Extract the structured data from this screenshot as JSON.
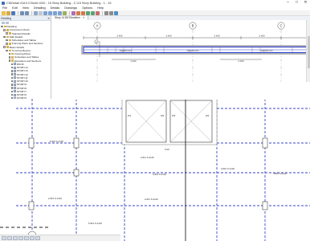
{
  "window": {
    "title": "CSiDetail v18.0.0 Build 1020 - 15 Story Building - C:\\15 Story Building - 1 - 15",
    "minimize_glyph": "–",
    "maximize_glyph": "□",
    "close_glyph": "✕"
  },
  "menu": [
    "File",
    "Edit",
    "View",
    "Detailing",
    "Details",
    "Drawings",
    "Options",
    "Help"
  ],
  "left_pane": {
    "header": "Detailing",
    "close_glyph": "✕",
    "tree": [
      {
        "label": "Detailing",
        "level": 0,
        "expand": "−",
        "kind": "folder"
      },
      {
        "label": "Component Views",
        "level": 1,
        "expand": "−",
        "kind": "folder"
      },
      {
        "label": "Standard Details",
        "level": 2,
        "expand": "+",
        "kind": "folder"
      },
      {
        "label": "Slab Details",
        "level": 1,
        "expand": "−",
        "kind": "folder"
      },
      {
        "label": "Schedules and Tables",
        "level": 2,
        "expand": "+",
        "kind": "folder"
      },
      {
        "label": "Framing Plans and Sections",
        "level": 2,
        "expand": "+",
        "kind": "folder"
      },
      {
        "label": "Beam Details",
        "level": 1,
        "expand": "−",
        "kind": "folder"
      },
      {
        "label": "Concrete Beams",
        "level": 2,
        "expand": "−",
        "kind": "folder"
      },
      {
        "label": "Framing Plans",
        "level": 3,
        "expand": "+",
        "kind": "folder"
      },
      {
        "label": "Schedules and Tables",
        "level": 3,
        "expand": "+",
        "kind": "folder"
      },
      {
        "label": "Elevations and Sections",
        "level": 3,
        "expand": "−",
        "kind": "folder"
      },
      {
        "label": "ROOF",
        "level": 4,
        "expand": "+",
        "kind": "doc"
      },
      {
        "label": "STORY14",
        "level": 4,
        "expand": "+",
        "kind": "doc"
      },
      {
        "label": "STORY13",
        "level": 4,
        "expand": "+",
        "kind": "doc"
      },
      {
        "label": "STORY12",
        "level": 4,
        "expand": "+",
        "kind": "doc"
      },
      {
        "label": "STORY11",
        "level": 4,
        "expand": "+",
        "kind": "doc"
      },
      {
        "label": "STORY10",
        "level": 4,
        "expand": "+",
        "kind": "doc"
      },
      {
        "label": "STORY9",
        "level": 4,
        "expand": "+",
        "kind": "doc"
      },
      {
        "label": "STORY8",
        "level": 4,
        "expand": "+",
        "kind": "doc"
      },
      {
        "label": "STORY7",
        "level": 4,
        "expand": "+",
        "kind": "doc"
      },
      {
        "label": "STORY6",
        "level": 4,
        "expand": "+",
        "kind": "doc"
      },
      {
        "label": "STORY5",
        "level": 4,
        "expand": "+",
        "kind": "doc"
      },
      {
        "label": "B1B2 (No values)",
        "level": 4,
        "expand": "+",
        "kind": "doc"
      },
      {
        "label": "B3B1",
        "level": 4,
        "expand": "+",
        "kind": "doc"
      },
      {
        "label": "B3B2",
        "level": 4,
        "expand": "+",
        "kind": "doc"
      }
    ]
  },
  "view_tab": {
    "label": "Story 14 B3 Elevation",
    "close_glyph": "✕"
  },
  "elevation": {
    "grid_bubbles": [
      "A",
      "B",
      "C"
    ],
    "dimensions": [
      "2 #10",
      "2 #10",
      "2 #10",
      "2 #10"
    ],
    "bar_labels": [
      "10@200 mm",
      "10@200 mm",
      "10@200 mm"
    ],
    "bottom_labels": [
      "4 #10",
      "4 #10"
    ],
    "section_mark": "A"
  },
  "plan": {
    "beam_labels": [
      "5-#10 S-4140",
      "2-#11 S-4140",
      "3-#10 S-4140",
      "5-#10 S-4140",
      "2-#10 S-4140",
      "2-#11 S-4140",
      "3-#10 S-4140",
      "5-#10 S-4140"
    ],
    "wall_tags": [
      "W1",
      "W2",
      "W3",
      "W4"
    ],
    "center_tag": "C40",
    "grid_bubble": "1"
  }
}
